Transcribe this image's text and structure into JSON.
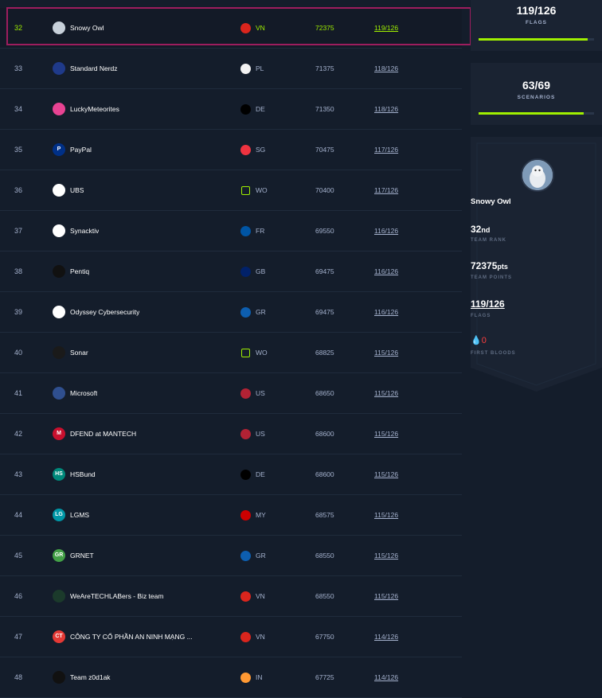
{
  "rows": [
    {
      "rank": "32",
      "name": "Snowy Owl",
      "cc": "VN",
      "points": "72375",
      "flags": "119/126",
      "logo_color": "#c7d0da",
      "logo_text": "",
      "flag_color": "#da251d",
      "highlight": true
    },
    {
      "rank": "33",
      "name": "Standard Nerdz",
      "cc": "PL",
      "points": "71375",
      "flags": "118/126",
      "logo_color": "#1f3a8a",
      "logo_text": "",
      "flag_color": "#f2f2f2"
    },
    {
      "rank": "34",
      "name": "LuckyMeteorites",
      "cc": "DE",
      "points": "71350",
      "flags": "118/126",
      "logo_color": "#e84393",
      "logo_text": "",
      "flag_color": "#000000"
    },
    {
      "rank": "35",
      "name": "PayPal",
      "cc": "SG",
      "points": "70475",
      "flags": "117/126",
      "logo_color": "#003087",
      "logo_text": "P",
      "flag_color": "#ef3340"
    },
    {
      "rank": "36",
      "name": "UBS",
      "cc": "WO",
      "points": "70400",
      "flags": "117/126",
      "logo_color": "#ffffff",
      "logo_text": "",
      "flag_color": "globe"
    },
    {
      "rank": "37",
      "name": "Synacktiv",
      "cc": "FR",
      "points": "69550",
      "flags": "116/126",
      "logo_color": "#ffffff",
      "logo_text": "",
      "flag_color": "#0055a4"
    },
    {
      "rank": "38",
      "name": "Pentiq",
      "cc": "GB",
      "points": "69475",
      "flags": "116/126",
      "logo_color": "#111111",
      "logo_text": "",
      "flag_color": "#012169"
    },
    {
      "rank": "39",
      "name": "Odyssey Cybersecurity",
      "cc": "GR",
      "points": "69475",
      "flags": "116/126",
      "logo_color": "#ffffff",
      "logo_text": "",
      "flag_color": "#0d5eaf"
    },
    {
      "rank": "40",
      "name": "Sonar",
      "cc": "WO",
      "points": "68825",
      "flags": "115/126",
      "logo_color": "#1a1a1a",
      "logo_text": "",
      "flag_color": "globe"
    },
    {
      "rank": "41",
      "name": "Microsoft",
      "cc": "US",
      "points": "68650",
      "flags": "115/126",
      "logo_color": "#2f4f8f",
      "logo_text": "",
      "flag_color": "#b22234"
    },
    {
      "rank": "42",
      "name": "DFEND at MANTECH",
      "cc": "US",
      "points": "68600",
      "flags": "115/126",
      "logo_color": "#c8102e",
      "logo_text": "M",
      "flag_color": "#b22234"
    },
    {
      "rank": "43",
      "name": "HSBund",
      "cc": "DE",
      "points": "68600",
      "flags": "115/126",
      "logo_color": "#00897b",
      "logo_text": "HS",
      "flag_color": "#000000"
    },
    {
      "rank": "44",
      "name": "LGMS",
      "cc": "MY",
      "points": "68575",
      "flags": "115/126",
      "logo_color": "#0097a7",
      "logo_text": "LG",
      "flag_color": "#cc0001"
    },
    {
      "rank": "45",
      "name": "GRNET",
      "cc": "GR",
      "points": "68550",
      "flags": "115/126",
      "logo_color": "#43a047",
      "logo_text": "GR",
      "flag_color": "#0d5eaf"
    },
    {
      "rank": "46",
      "name": "WeAreTECHLABers - Biz team",
      "cc": "VN",
      "points": "68550",
      "flags": "115/126",
      "logo_color": "#1b3a2b",
      "logo_text": "",
      "flag_color": "#da251d"
    },
    {
      "rank": "47",
      "name": "CÔNG TY CỔ PHẦN AN NINH MẠNG ...",
      "cc": "VN",
      "points": "67750",
      "flags": "114/126",
      "logo_color": "#e53935",
      "logo_text": "CT",
      "flag_color": "#da251d"
    },
    {
      "rank": "48",
      "name": "Team z0d1ak",
      "cc": "IN",
      "points": "67725",
      "flags": "114/126",
      "logo_color": "#111111",
      "logo_text": "",
      "flag_color": "#ff9933"
    }
  ],
  "summary": {
    "flags_value": "119/126",
    "flags_label": "FLAGS",
    "flags_progress": 0.944,
    "scenarios_value": "63/69",
    "scenarios_label": "SCENARIOS",
    "scenarios_progress": 0.913
  },
  "team": {
    "name": "Snowy Owl",
    "rank_num": "32",
    "rank_suffix": "nd",
    "rank_label": "TEAM RANK",
    "points_num": "72375",
    "points_suffix": "pts",
    "points_label": "TEAM POINTS",
    "flags": "119/126",
    "flags_label": "FLAGS",
    "first_bloods": "0",
    "first_bloods_label": "FIRST BLOODS"
  },
  "colors": {
    "accent": "#9fef00",
    "highlight_border": "#9d1d5e",
    "blood": "#ff3e3e"
  }
}
